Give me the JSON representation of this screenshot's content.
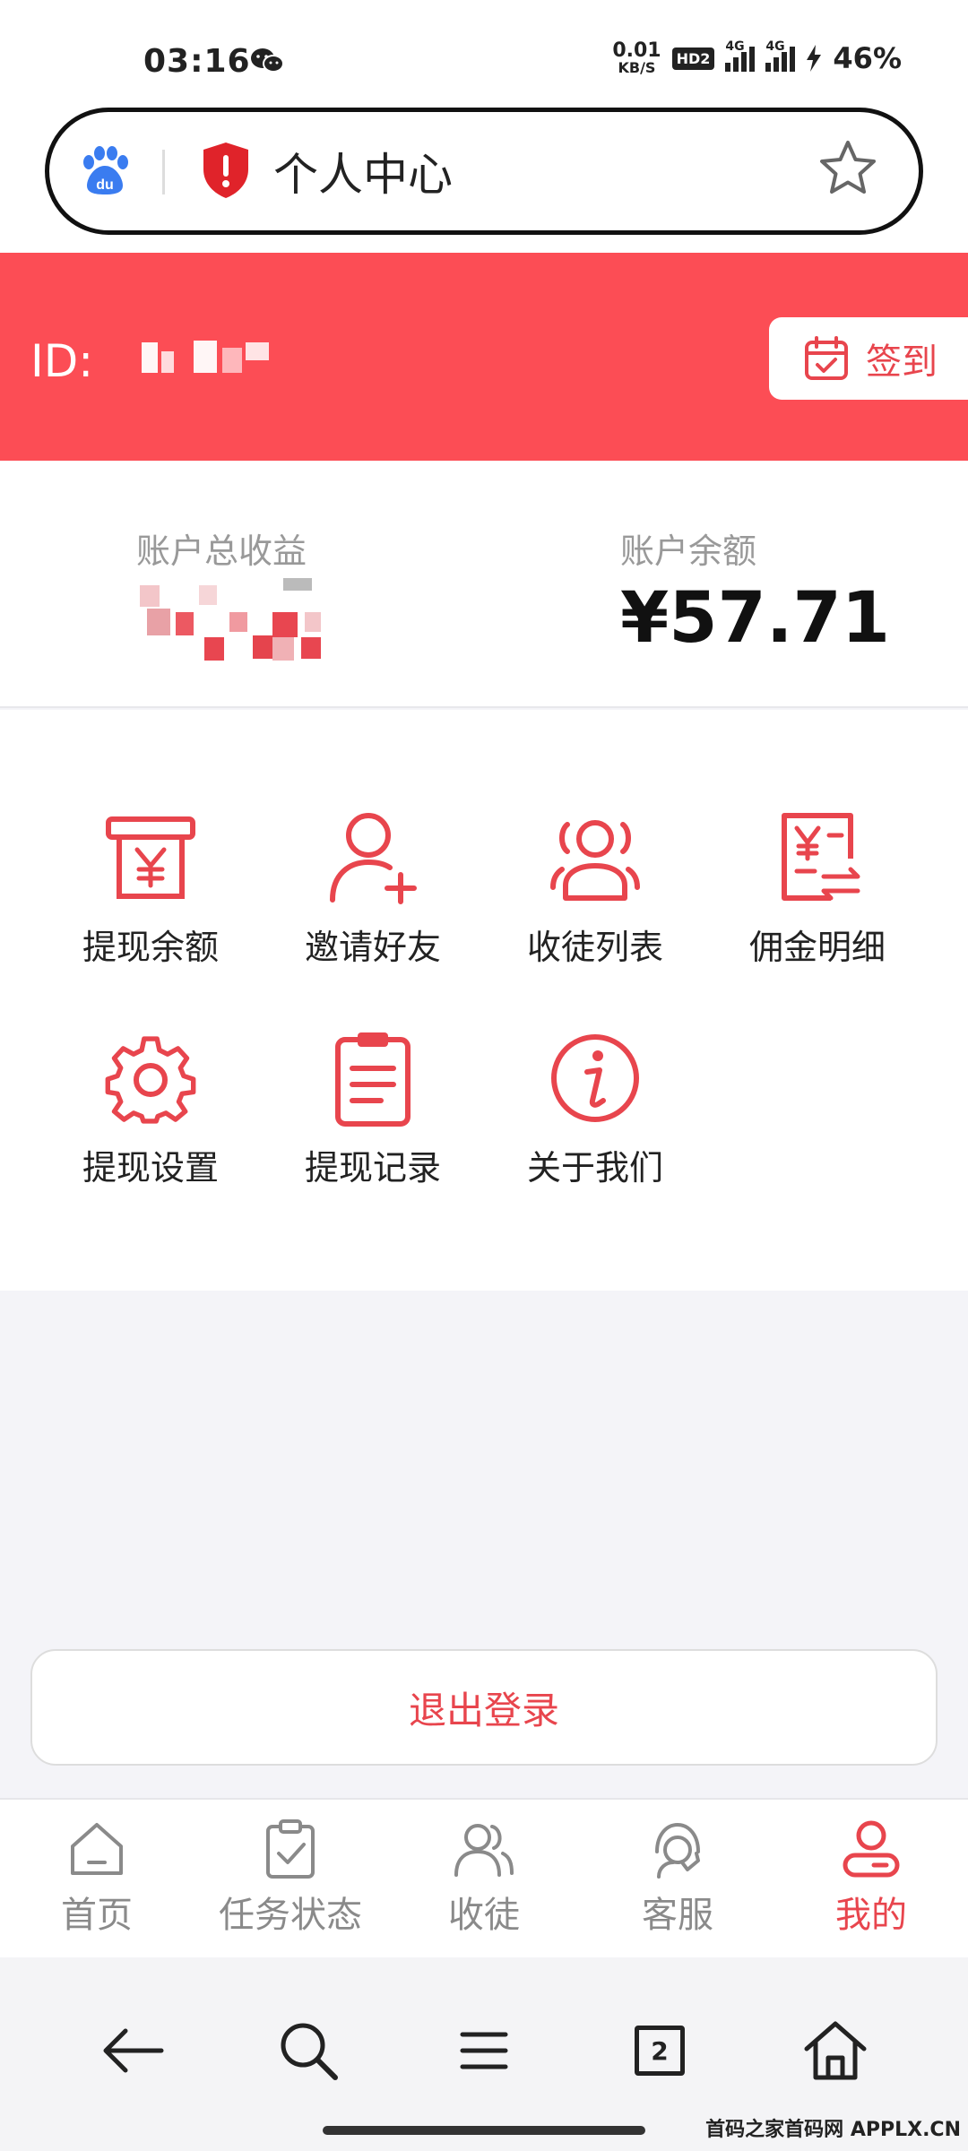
{
  "status_bar": {
    "time": "03:16",
    "net_speed_value": "0.01",
    "net_speed_unit": "KB/S",
    "hd_badge": "HD2",
    "signal1": "4G",
    "signal2": "4G",
    "battery": "46%",
    "icons": [
      "wechat-icon",
      "signal-icon",
      "charging-icon"
    ]
  },
  "browser": {
    "title": "个人中心",
    "icons": [
      "baidu-logo",
      "shield-alert-icon",
      "star-icon"
    ]
  },
  "profile": {
    "id_label": "ID:",
    "checkin_label": "签到",
    "accent_color": "#fc4d55"
  },
  "stats": {
    "total_income_label": "账户总收益",
    "balance_label": "账户余额",
    "balance_value": "¥57.71"
  },
  "menu": {
    "items": [
      {
        "label": "提现余额",
        "icon": "withdraw-icon"
      },
      {
        "label": "邀请好友",
        "icon": "invite-friend-icon"
      },
      {
        "label": "收徒列表",
        "icon": "apprentice-list-icon"
      },
      {
        "label": "佣金明细",
        "icon": "commission-detail-icon"
      },
      {
        "label": "提现设置",
        "icon": "settings-gear-icon"
      },
      {
        "label": "提现记录",
        "icon": "record-clipboard-icon"
      },
      {
        "label": "关于我们",
        "icon": "info-icon"
      }
    ]
  },
  "logout": {
    "label": "退出登录"
  },
  "tabs": [
    {
      "label": "首页",
      "icon": "home-icon"
    },
    {
      "label": "任务状态",
      "icon": "task-clipboard-icon"
    },
    {
      "label": "收徒",
      "icon": "users-icon"
    },
    {
      "label": "客服",
      "icon": "headset-icon"
    },
    {
      "label": "我的",
      "icon": "profile-icon",
      "active": true
    }
  ],
  "browser_nav": {
    "tab_count": "2",
    "icons": [
      "back-arrow-icon",
      "search-icon",
      "menu-icon",
      "tabs-icon",
      "home-icon"
    ]
  },
  "watermark": "首码之家首码网 APPLX.CN"
}
